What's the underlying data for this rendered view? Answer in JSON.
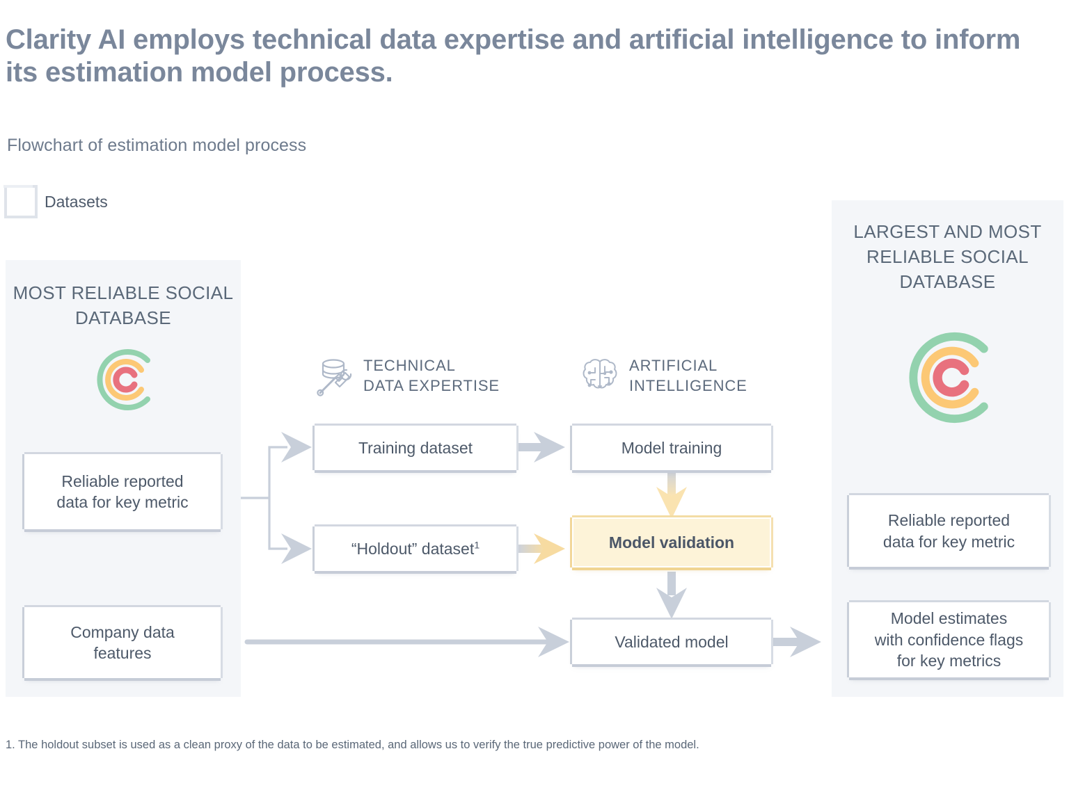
{
  "headline": "Clarity AI employs technical data expertise and artificial intelligence to inform its estimation model process.",
  "subheadline": "Flowchart of estimation model process",
  "legend": {
    "swatch_icon": "square-outline-icon",
    "label": "Datasets"
  },
  "panels": {
    "left": {
      "title": "MOST RELIABLE\nSOCIAL DATABASE",
      "logo_icon": "clarity-ai-logo",
      "boxes": [
        {
          "label": "Reliable reported\ndata for key metric"
        },
        {
          "label": "Company data\nfeatures"
        }
      ]
    },
    "right": {
      "title": "LARGEST AND\nMOST RELIABLE\nSOCIAL DATABASE",
      "logo_icon": "clarity-ai-logo",
      "boxes": [
        {
          "label": "Reliable reported\ndata for key metric"
        },
        {
          "label": "Model estimates\nwith confidence flags\nfor key metrics"
        }
      ]
    }
  },
  "columns": [
    {
      "icon": "database-tools-icon",
      "title": "TECHNICAL\nDATA EXPERTISE"
    },
    {
      "icon": "brain-circuit-icon",
      "title": "ARTIFICIAL\nINTELLIGENCE"
    }
  ],
  "nodes": {
    "training_dataset": "Training dataset",
    "holdout_dataset": "“Holdout” dataset",
    "holdout_footnote_marker": "1",
    "model_training": "Model training",
    "model_validation": "Model validation",
    "validated_model": "Validated model"
  },
  "footnote": "1. The holdout subset is used as a clean proxy of the data to be estimated, and allows us to verify the true predictive power of the model.",
  "colors": {
    "headline": "#7a879b",
    "text": "#4d5969",
    "panel_bg": "#f4f6f9",
    "box_bg": "#ffffff",
    "accent_bg": "#fdf3d8",
    "accent_border": "#f0d492",
    "arrow": "#c8cfda",
    "arrow_accent": "#f5d79a",
    "logo_green": "#93d2ae",
    "logo_orange": "#fcc875",
    "logo_pink": "#e8717e"
  },
  "chart_data": {
    "type": "diagram",
    "title": "Flowchart of estimation model process",
    "nodes": [
      {
        "id": "most_reliable_social_database",
        "label": "MOST RELIABLE SOCIAL DATABASE",
        "group": "source-panel"
      },
      {
        "id": "reliable_reported_data_left",
        "label": "Reliable reported data for key metric",
        "group": "source-panel"
      },
      {
        "id": "company_data_features",
        "label": "Company data features",
        "group": "source-panel"
      },
      {
        "id": "training_dataset",
        "label": "Training dataset",
        "group": "technical-data-expertise"
      },
      {
        "id": "holdout_dataset",
        "label": "“Holdout” dataset",
        "group": "technical-data-expertise"
      },
      {
        "id": "model_training",
        "label": "Model training",
        "group": "artificial-intelligence"
      },
      {
        "id": "model_validation",
        "label": "Model validation",
        "group": "artificial-intelligence",
        "highlighted": true
      },
      {
        "id": "validated_model",
        "label": "Validated model",
        "group": "artificial-intelligence"
      },
      {
        "id": "largest_and_most_reliable_social_database",
        "label": "LARGEST AND MOST RELIABLE SOCIAL DATABASE",
        "group": "output-panel"
      },
      {
        "id": "reliable_reported_data_right",
        "label": "Reliable reported data for key metric",
        "group": "output-panel"
      },
      {
        "id": "model_estimates",
        "label": "Model estimates with confidence flags for key metrics",
        "group": "output-panel"
      }
    ],
    "edges": [
      {
        "from": "reliable_reported_data_left",
        "to": "training_dataset"
      },
      {
        "from": "reliable_reported_data_left",
        "to": "holdout_dataset"
      },
      {
        "from": "training_dataset",
        "to": "model_training"
      },
      {
        "from": "holdout_dataset",
        "to": "model_validation"
      },
      {
        "from": "model_training",
        "to": "model_validation"
      },
      {
        "from": "model_validation",
        "to": "validated_model"
      },
      {
        "from": "company_data_features",
        "to": "validated_model"
      },
      {
        "from": "validated_model",
        "to": "largest_and_most_reliable_social_database"
      }
    ]
  }
}
